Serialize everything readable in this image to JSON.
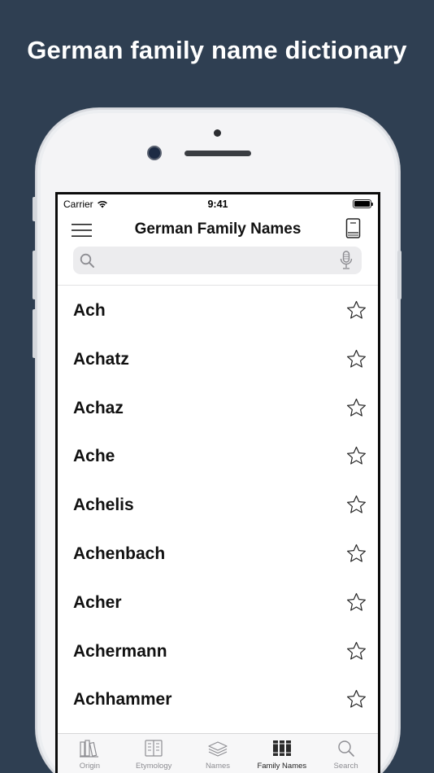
{
  "headline": "German family name dictionary",
  "status_bar": {
    "carrier": "Carrier",
    "time": "9:41"
  },
  "nav": {
    "title": "German Family Names"
  },
  "search": {
    "placeholder": "",
    "value": ""
  },
  "names": [
    {
      "label": "Ach",
      "favorite": false
    },
    {
      "label": "Achatz",
      "favorite": false
    },
    {
      "label": "Achaz",
      "favorite": false
    },
    {
      "label": "Ache",
      "favorite": false
    },
    {
      "label": "Achelis",
      "favorite": false
    },
    {
      "label": "Achenbach",
      "favorite": false
    },
    {
      "label": "Acher",
      "favorite": false
    },
    {
      "label": "Achermann",
      "favorite": false
    },
    {
      "label": "Achhammer",
      "favorite": false
    }
  ],
  "tabs": [
    {
      "label": "Origin",
      "icon": "books-icon"
    },
    {
      "label": "Etymology",
      "icon": "dictionary-icon"
    },
    {
      "label": "Names",
      "icon": "layers-icon"
    },
    {
      "label": "Family Names",
      "icon": "bookshelf-icon",
      "active": true
    },
    {
      "label": "Search",
      "icon": "search-icon"
    }
  ],
  "colors": {
    "background": "#2f3f52",
    "active_tab": "#222222",
    "inactive_tab": "#8e8e93"
  }
}
